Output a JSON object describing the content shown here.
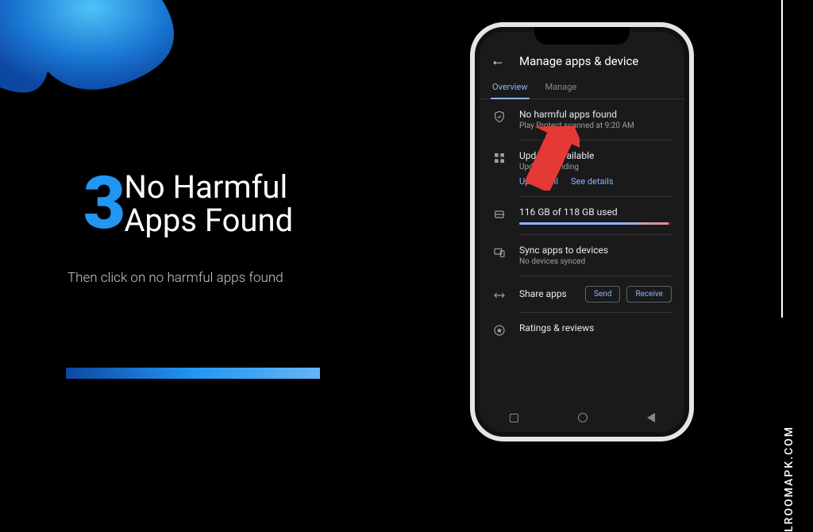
{
  "step": {
    "number": "3",
    "title_line1": "No Harmful",
    "title_line2": "Apps Found",
    "instruction": "Then click on no harmful apps found"
  },
  "watermark": "LROOMAPK.COM",
  "phone": {
    "header_title": "Manage apps & device",
    "tabs": {
      "overview": "Overview",
      "manage": "Manage"
    },
    "protect": {
      "title": "No harmful apps found",
      "sub": "Play Protect scanned at 9:20 AM"
    },
    "updates": {
      "title": "Updates available",
      "sub": "Updates pending",
      "update_all": "Update all",
      "see_details": "See details"
    },
    "storage": {
      "title": "116 GB of 118 GB used"
    },
    "sync": {
      "title": "Sync apps to devices",
      "sub": "No devices synced"
    },
    "share": {
      "title": "Share apps",
      "send": "Send",
      "receive": "Receive"
    },
    "ratings": {
      "title": "Ratings & reviews"
    }
  }
}
